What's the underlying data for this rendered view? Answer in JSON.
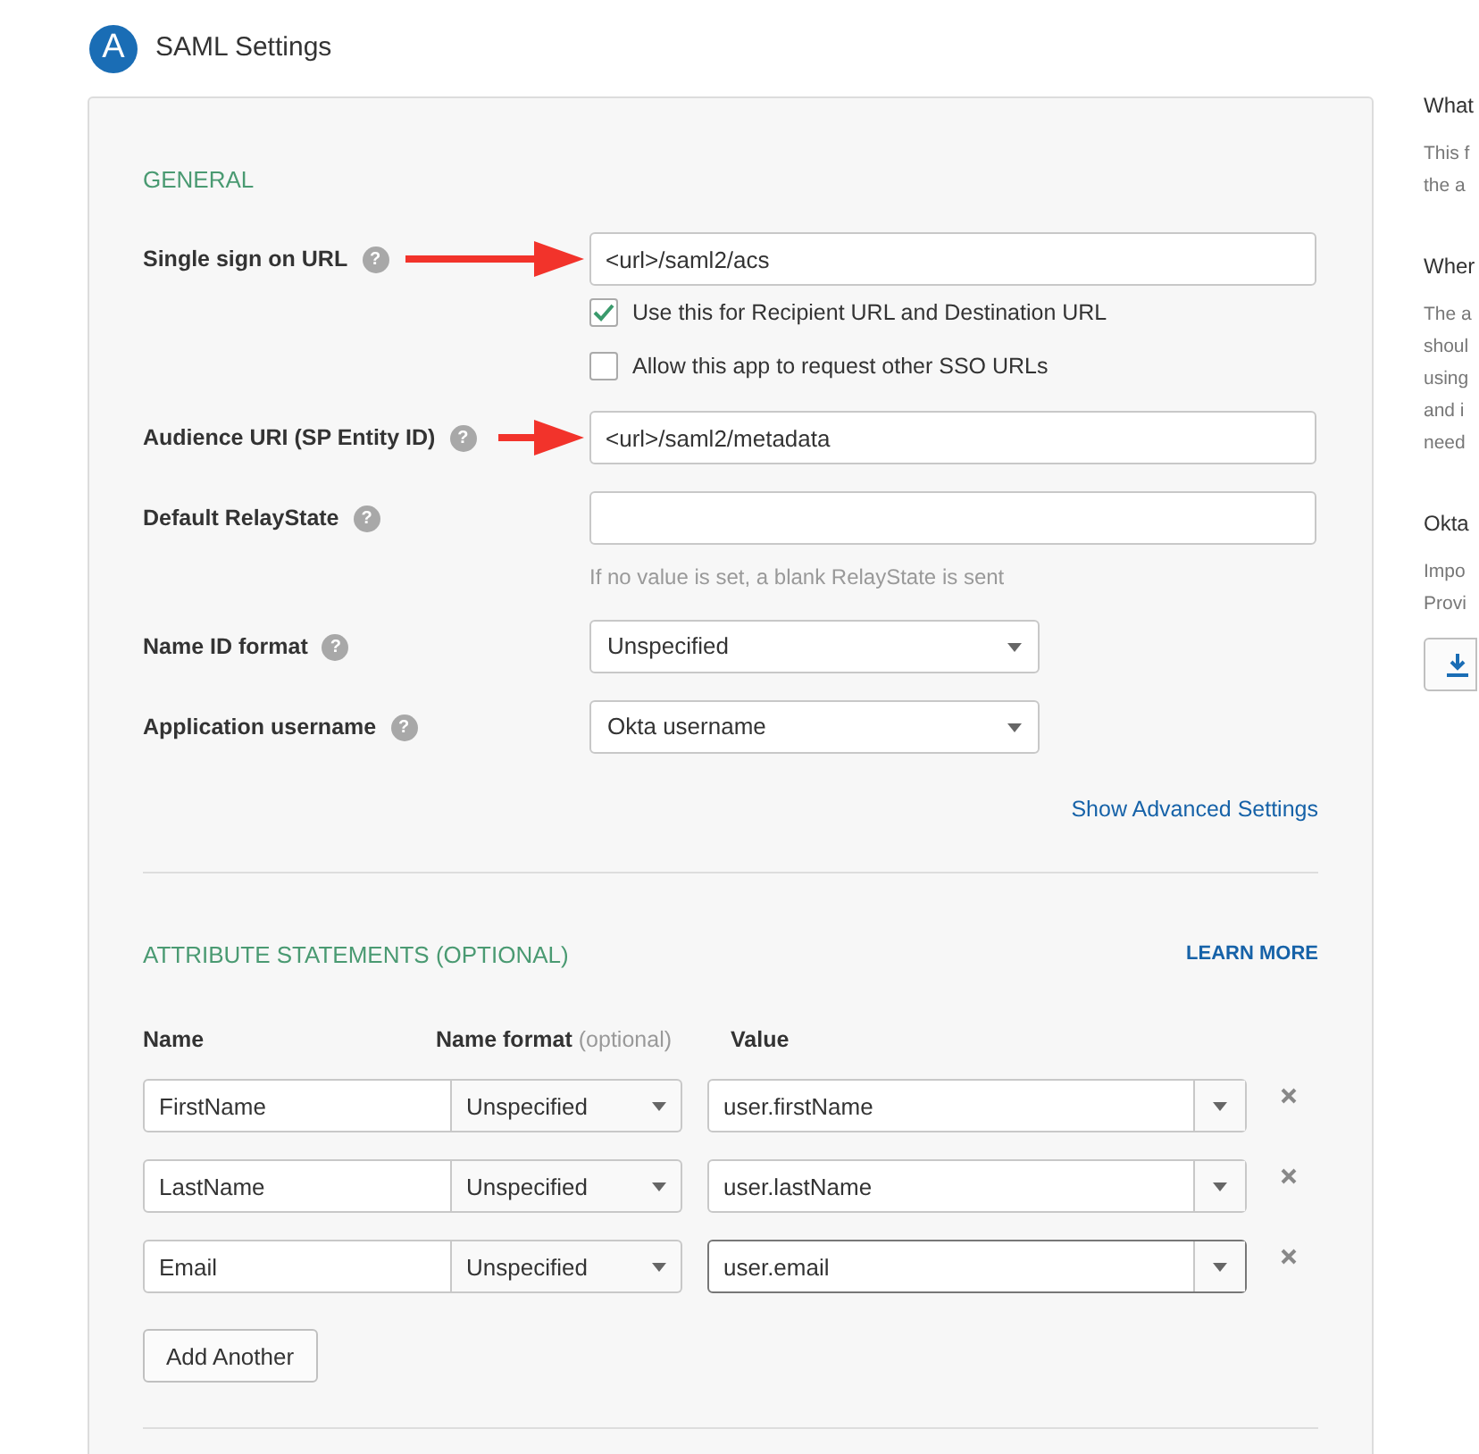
{
  "header": {
    "badge": "A",
    "title": "SAML Settings"
  },
  "general": {
    "heading": "GENERAL",
    "fields": [
      {
        "kind": "text",
        "label": "Single sign on URL",
        "help": "?",
        "value": "<url>/saml2/acs",
        "arrow": true,
        "checkboxes": [
          {
            "label": "Use this for Recipient URL and Destination URL",
            "checked": true
          },
          {
            "label": "Allow this app to request other SSO URLs",
            "checked": false
          }
        ]
      },
      {
        "kind": "text",
        "label": "Audience URI (SP Entity ID)",
        "help": "?",
        "value": "<url>/saml2/metadata",
        "arrow": true
      },
      {
        "kind": "text",
        "label": "Default RelayState",
        "help": "?",
        "hint": "If no value is set, a blank RelayState is sent"
      },
      {
        "kind": "select",
        "label": "Name ID format",
        "help": "?",
        "value": "Unspecified"
      },
      {
        "kind": "select",
        "label": "Application username",
        "help": "?",
        "value": "Okta username"
      }
    ],
    "advanced_link": "Show Advanced Settings"
  },
  "attributes": {
    "heading": "ATTRIBUTE STATEMENTS (OPTIONAL)",
    "learn_more": "LEARN MORE",
    "columns": [
      {
        "label": "Name"
      },
      {
        "label": "Name format",
        "note": "(optional)"
      },
      {
        "label": "Value"
      }
    ],
    "rows": [
      {
        "name": "FirstName",
        "name_format": "Unspecified",
        "value": "user.firstName",
        "focused": false
      },
      {
        "name": "LastName",
        "name_format": "Unspecified",
        "value": "user.lastName",
        "focused": false
      },
      {
        "name": "Email",
        "name_format": "Unspecified",
        "value": "user.email",
        "focused": true
      }
    ],
    "add_button": "Add Another"
  },
  "sidebar": {
    "sections": [
      {
        "heading": "What",
        "lines": [
          "This f",
          "the a"
        ]
      },
      {
        "heading": "Wher",
        "lines": [
          "The a",
          "shoul",
          "using",
          "and i",
          "need"
        ]
      },
      {
        "heading": "Okta",
        "lines": [
          "Impo",
          "Provi"
        ],
        "download_button": true
      }
    ]
  }
}
